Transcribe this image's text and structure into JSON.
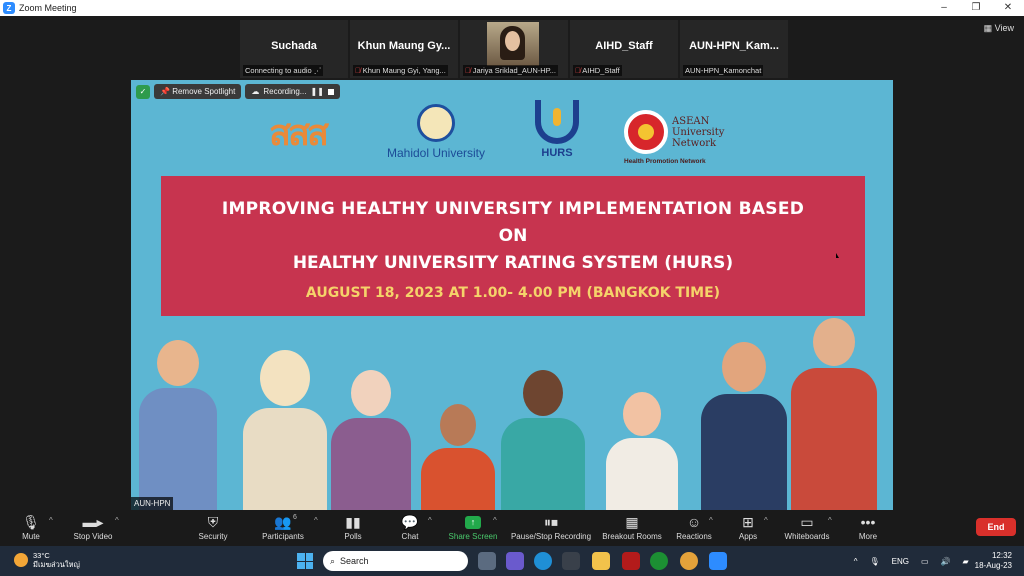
{
  "window": {
    "title": "Zoom Meeting",
    "controls": [
      "–",
      "❐",
      "✕"
    ]
  },
  "view_label": "View",
  "participants_strip": [
    {
      "name": "Suchada",
      "status": "Connecting to audio"
    },
    {
      "name": "Khun Maung Gy...",
      "status": "Khun Maung Gyi, Yang..."
    },
    {
      "name": "",
      "status": "Jariya Sriklad_AUN-HP..."
    },
    {
      "name": "AIHD_Staff",
      "status": "AIHD_Staff"
    },
    {
      "name": "AUN-HPN_Kam...",
      "status": "AUN-HPN_Kamonchat"
    }
  ],
  "share_bar": {
    "remove_spotlight": "Remove Spotlight",
    "recording": "Recording..."
  },
  "slide": {
    "logo_sss": "สสส",
    "logo_mahidol": "Mahidol University",
    "logo_hurs": "HURS",
    "logo_aun_lines": [
      "ASEAN",
      "University",
      "Network"
    ],
    "logo_aun_sub": "Health Promotion Network",
    "title_line1": "IMPROVING HEALTHY UNIVERSITY IMPLEMENTATION BASED",
    "title_line2": "ON",
    "title_line3": "HEALTHY UNIVERSITY RATING SYSTEM (HURS)",
    "date_line": "AUGUST 18, 2023 AT 1.00- 4.00 PM (BANGKOK TIME)"
  },
  "speaker_tag": "AUN-HPN",
  "toolbar": {
    "mute": "Mute",
    "stop_video": "Stop Video",
    "security": "Security",
    "participants": "Participants",
    "participants_count": "6",
    "polls": "Polls",
    "chat": "Chat",
    "share_screen": "Share Screen",
    "pause_recording": "Pause/Stop Recording",
    "breakout_rooms": "Breakout Rooms",
    "reactions": "Reactions",
    "apps": "Apps",
    "whiteboards": "Whiteboards",
    "more": "More",
    "end": "End"
  },
  "taskbar": {
    "temperature": "33°C",
    "weather_text": "มีเมฆส่วนใหญ่",
    "search_placeholder": "Search",
    "language": "ENG",
    "time": "12:32",
    "date": "18-Aug-23"
  },
  "colors": {
    "slide_bg": "#5cb6d3",
    "banner": "#c7344f",
    "date_text": "#f5d36a",
    "share_green": "#22a94b",
    "end_red": "#d9302b"
  }
}
